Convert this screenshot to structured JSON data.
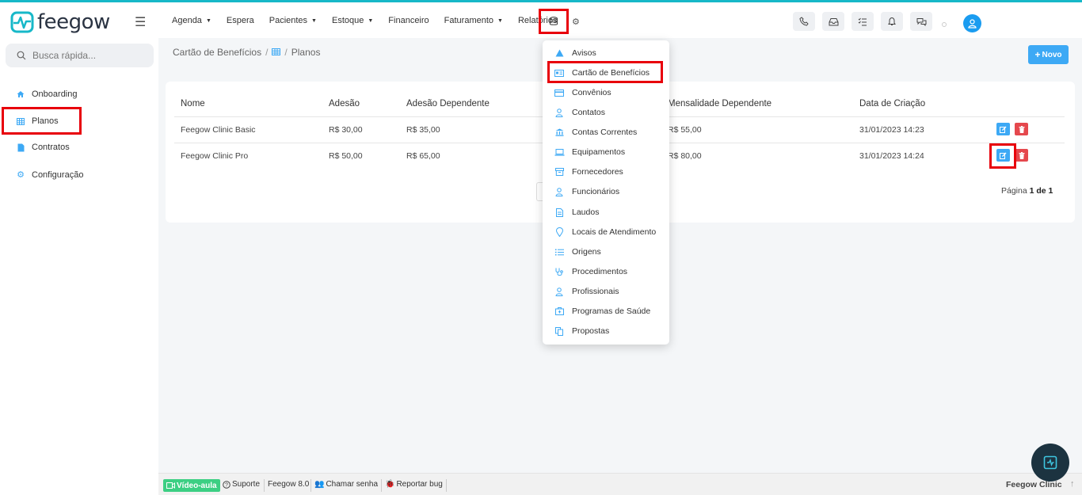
{
  "app": {
    "logo_text": "feegow",
    "accent_color": "#17b8c8"
  },
  "nav": {
    "items": [
      {
        "label": "Agenda",
        "has_caret": true
      },
      {
        "label": "Espera",
        "has_caret": false
      },
      {
        "label": "Pacientes",
        "has_caret": true
      },
      {
        "label": "Estoque",
        "has_caret": true
      },
      {
        "label": "Financeiro",
        "has_caret": false
      },
      {
        "label": "Faturamento",
        "has_caret": true
      },
      {
        "label": "Relatórios",
        "has_caret": false
      }
    ],
    "icons": [
      "database-icon",
      "gear-icon"
    ],
    "top_icons": [
      "phone-icon",
      "inbox-icon",
      "checklist-icon",
      "bell-icon",
      "chat-icon"
    ]
  },
  "sidebar": {
    "search_placeholder": "Busca rápida...",
    "items": [
      {
        "label": "Onboarding",
        "icon": "home-icon"
      },
      {
        "label": "Planos",
        "icon": "table-icon"
      },
      {
        "label": "Contratos",
        "icon": "file-icon"
      },
      {
        "label": "Configuração",
        "icon": "gear-icon"
      }
    ]
  },
  "breadcrumb": {
    "parent": "Cartão de Benefícios",
    "sep": "/",
    "current": "Planos"
  },
  "actions": {
    "new_label": "Novo"
  },
  "table": {
    "headers": [
      "Nome",
      "Adesão",
      "Adesão Dependente",
      "Mensalidade Dependente",
      "Data de Criação"
    ],
    "rows": [
      {
        "nome": "Feegow Clinic Basic",
        "adesao": "R$ 30,00",
        "adesao_dep": "R$ 35,00",
        "mens_dep": "R$ 55,00",
        "data": "31/01/2023 14:23"
      },
      {
        "nome": "Feegow Clinic Pro",
        "adesao": "R$ 50,00",
        "adesao_dep": "R$ 65,00",
        "mens_dep": "R$ 80,00",
        "data": "31/01/2023 14:24"
      }
    ],
    "pager": {
      "prefix": "Página",
      "current": "1 de 1"
    }
  },
  "dropdown": {
    "items": [
      {
        "label": "Avisos",
        "icon": "warning-icon"
      },
      {
        "label": "Cartão de Benefícios",
        "icon": "id-card-icon"
      },
      {
        "label": "Convênios",
        "icon": "credit-card-icon"
      },
      {
        "label": "Contatos",
        "icon": "user-icon"
      },
      {
        "label": "Contas Correntes",
        "icon": "bank-icon"
      },
      {
        "label": "Equipamentos",
        "icon": "laptop-icon"
      },
      {
        "label": "Fornecedores",
        "icon": "archive-icon"
      },
      {
        "label": "Funcionários",
        "icon": "user-icon"
      },
      {
        "label": "Laudos",
        "icon": "document-icon"
      },
      {
        "label": "Locais de Atendimento",
        "icon": "location-pin-icon"
      },
      {
        "label": "Origens",
        "icon": "list-icon"
      },
      {
        "label": "Procedimentos",
        "icon": "stethoscope-icon"
      },
      {
        "label": "Profissionais",
        "icon": "user-icon"
      },
      {
        "label": "Programas de Saúde",
        "icon": "medical-kit-icon"
      },
      {
        "label": "Propostas",
        "icon": "copy-icon"
      }
    ]
  },
  "footer": {
    "video": "Vídeo-aula",
    "support": "Suporte",
    "version": "Feegow 8.0",
    "call_password": "Chamar senha",
    "report_bug": "Reportar bug",
    "brand": "Feegow Clinic"
  }
}
